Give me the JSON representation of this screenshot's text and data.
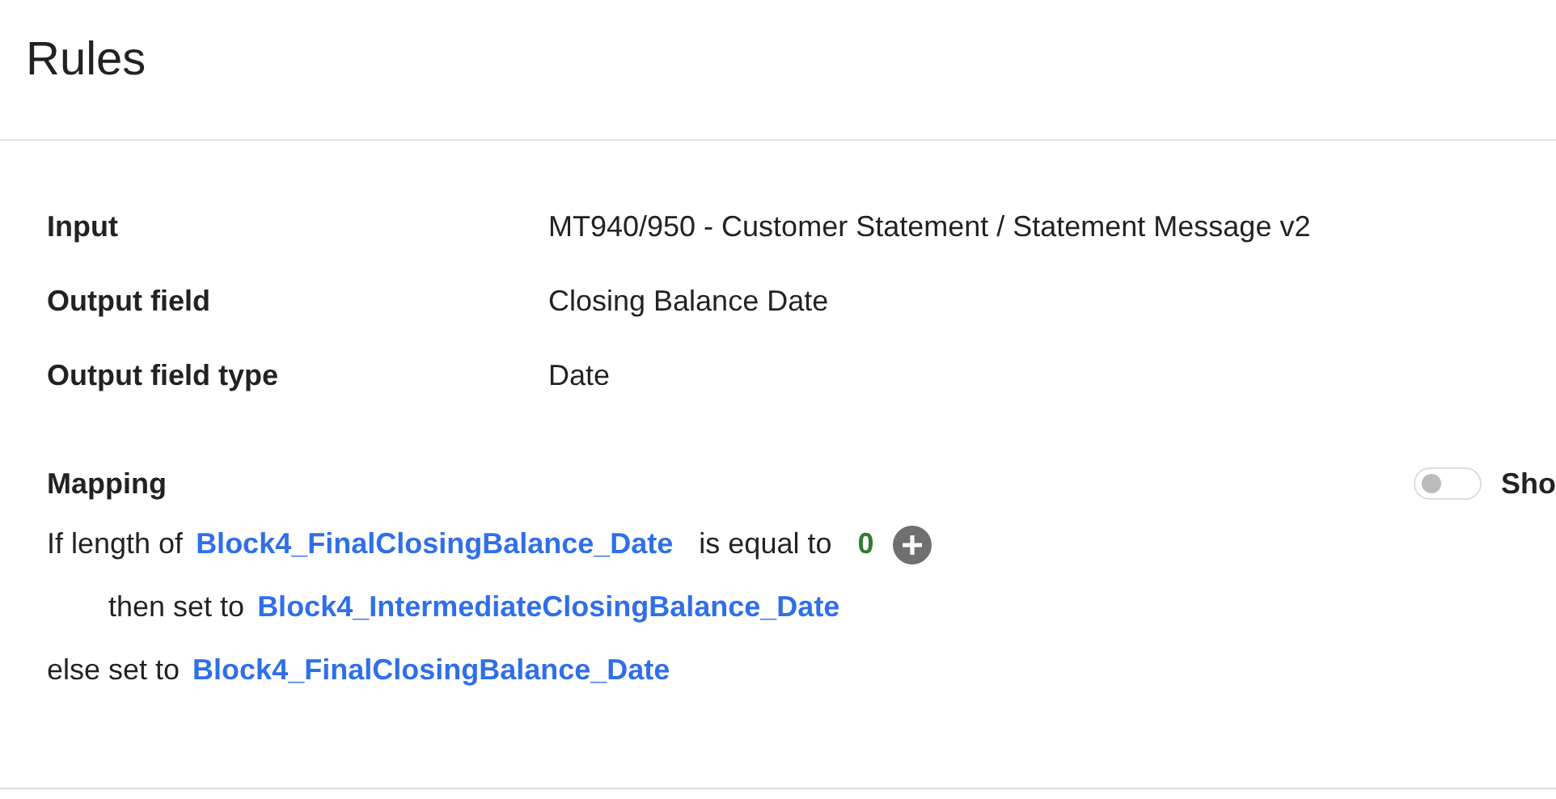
{
  "title": "Rules",
  "properties": [
    {
      "label": "Input",
      "value": "MT940/950 - Customer Statement / Statement Message v2"
    },
    {
      "label": "Output field",
      "value": "Closing Balance Date"
    },
    {
      "label": "Output field type",
      "value": "Date"
    }
  ],
  "mapping": {
    "heading": "Mapping",
    "toggle": {
      "on": false,
      "label": "Sho"
    },
    "condition": {
      "prefix": "If length of",
      "field": "Block4_FinalClosingBalance_Date",
      "operator": "is equal to",
      "value": "0"
    },
    "then": {
      "prefix": "then set to",
      "field": "Block4_IntermediateClosingBalance_Date"
    },
    "else": {
      "prefix": "else set to",
      "field": "Block4_FinalClosingBalance_Date"
    }
  }
}
